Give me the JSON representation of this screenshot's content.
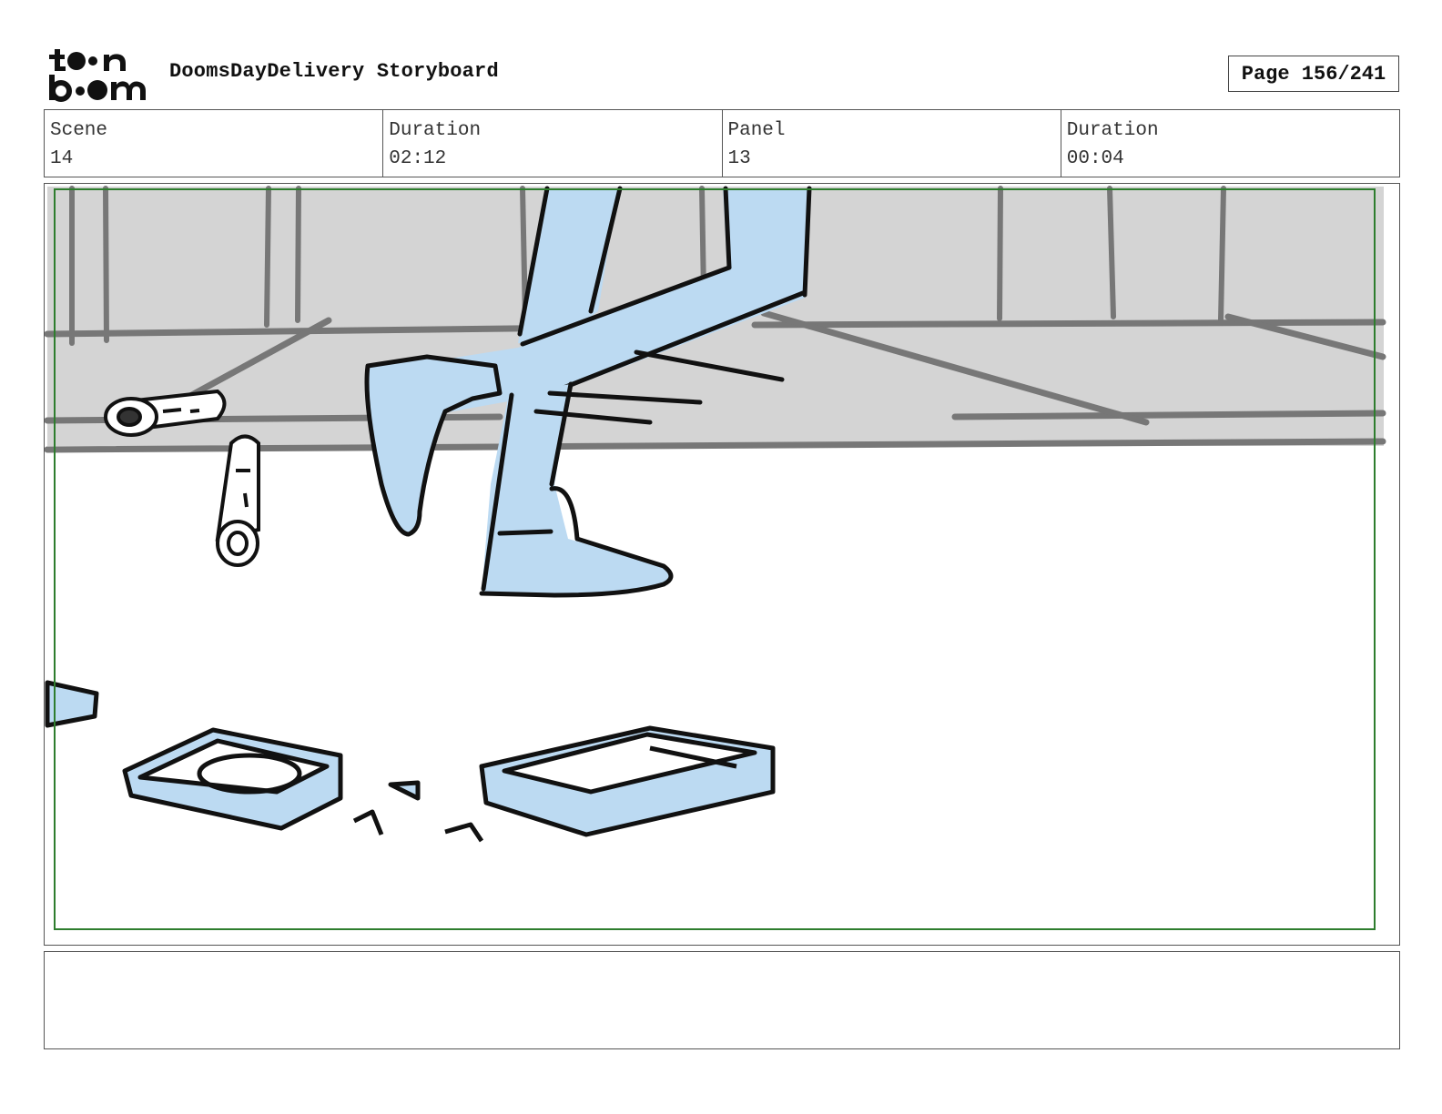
{
  "header": {
    "logo_text_line1": "toon",
    "logo_text_line2": "boom",
    "title": "DoomsDayDelivery Storyboard",
    "page": "Page 156/241"
  },
  "info": {
    "scene_label": "Scene",
    "scene_value": "14",
    "duration_label": "Duration",
    "duration_value": "02:12",
    "panel_label": "Panel",
    "panel_value": "13",
    "panel_duration_label": "Duration",
    "panel_duration_value": "00:04"
  },
  "panel": {
    "safe_frame_color": "#2e7d2e",
    "wall_color": "#d4d4d4",
    "fill_color": "#bcdaf2",
    "line_color": "#111111"
  },
  "notes": {
    "text": ""
  }
}
